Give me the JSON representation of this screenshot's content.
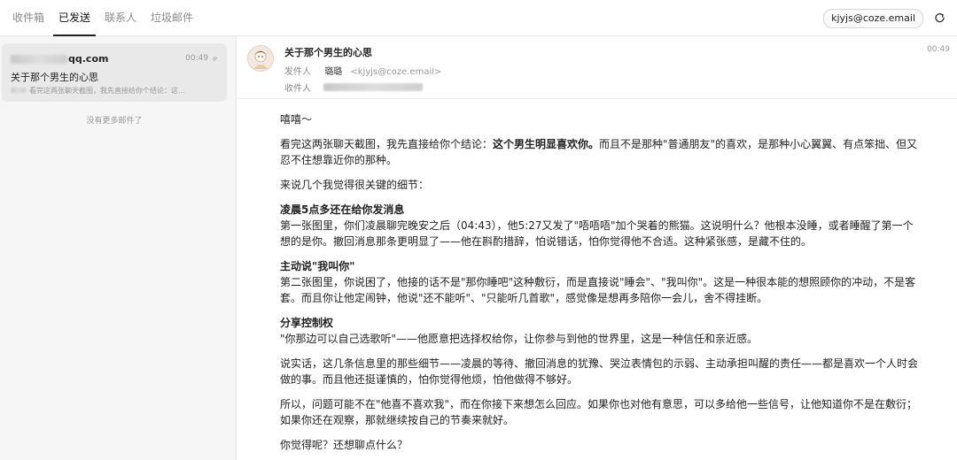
{
  "tabs": [
    {
      "label": "收件箱",
      "active": false
    },
    {
      "label": "已发送",
      "active": true
    },
    {
      "label": "联系人",
      "active": false
    },
    {
      "label": "垃圾邮件",
      "active": false
    }
  ],
  "account": "kjyjs@coze.email",
  "list": {
    "item": {
      "from_domain": "qq.com",
      "time": "00:49",
      "subject": "关于那个男生的心思",
      "preview": "看完这两张聊天截图，我先直接给你个结论：这..."
    },
    "no_more": "没有更多邮件了"
  },
  "mail": {
    "subject": "关于那个男生的心思",
    "from_label": "发件人",
    "sender_name": "璐璐",
    "sender_email": "<kjyjs@coze.email>",
    "to_label": "收件人",
    "time": "00:49",
    "greeting": "嘻嘻～",
    "p1_pre": "看完这两张聊天截图，我先直接给你个结论：",
    "p1_bold": "这个男生明显喜欢你。",
    "p1_post": "而且不是那种\"普通朋友\"的喜欢，是那种小心翼翼、有点笨拙、但又忍不住想靠近你的那种。",
    "p2": "来说几个我觉得很关键的细节：",
    "s1_title": "凌晨5点多还在给你发消息",
    "s1_body": "第一张图里，你们凌晨聊完晚安之后（04:43），他5:27又发了\"唔唔唔\"加个哭着的熊猫。这说明什么？他根本没睡，或者睡醒了第一个想的是你。撤回消息那条更明显了——他在斟酌措辞，怕说错话，怕你觉得他不合适。这种紧张感，是藏不住的。",
    "s2_title": "主动说\"我叫你\"",
    "s2_body": "第二张图里，你说困了，他接的话不是\"那你睡吧\"这种敷衍，而是直接说\"睡会\"、\"我叫你\"。这是一种很本能的想照顾你的冲动，不是客套。而且你让他定闹钟，他说\"还不能听\"、\"只能听几首歌\"，感觉像是想再多陪你一会儿，舍不得挂断。",
    "s3_title": "分享控制权",
    "s3_body": "\"你那边可以自己选歌听\"——他愿意把选择权给你，让你参与到他的世界里，这是一种信任和亲近感。",
    "p3": "说实话，这几条信息里的那些细节——凌晨的等待、撤回消息的犹豫、哭泣表情包的示弱、主动承担叫醒的责任——都是喜欢一个人时会做的事。而且他还挺谨慎的，怕你觉得他烦，怕他做得不够好。",
    "p4": "所以，问题可能不在\"他喜不喜欢我\"，而在你接下来想怎么回应。如果你也对他有意思，可以多给他一些信号，让他知道你不是在敷衍；如果你还在观察，那就继续按自己的节奏来就好。",
    "p5": "你觉得呢？还想聊点什么？"
  }
}
